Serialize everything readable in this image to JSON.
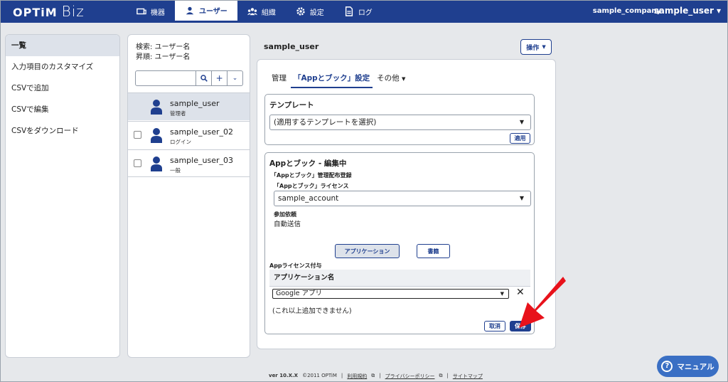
{
  "app": {
    "logo_main": "OPTiM",
    "logo_sub": "Biz",
    "company": "sample_company",
    "current_user": "sample_user"
  },
  "nav": {
    "items": [
      {
        "label": "機器",
        "icon": "device-icon"
      },
      {
        "label": "ユーザー",
        "icon": "user-icon"
      },
      {
        "label": "組織",
        "icon": "org-icon"
      },
      {
        "label": "設定",
        "icon": "gear-icon"
      },
      {
        "label": "ログ",
        "icon": "log-icon"
      }
    ]
  },
  "sidebar": {
    "items": [
      {
        "label": "一覧"
      },
      {
        "label": "入力項目のカスタマイズ"
      },
      {
        "label": "CSVで追加"
      },
      {
        "label": "CSVで編集"
      },
      {
        "label": "CSVをダウンロード"
      }
    ]
  },
  "list": {
    "search_label": "検索: ユーザー名",
    "sort_label": "昇順: ユーザー名",
    "search_placeholder": "",
    "users": [
      {
        "name": "sample_user",
        "role": "管理者"
      },
      {
        "name": "sample_user_02",
        "role": "ログイン"
      },
      {
        "name": "sample_user_03",
        "role": "一般"
      }
    ]
  },
  "detail": {
    "title": "sample_user",
    "op_button": "操作",
    "tabs": [
      {
        "label": "管理"
      },
      {
        "label": "「Appとブック」設定"
      },
      {
        "label": "その他"
      }
    ],
    "template": {
      "title": "テンプレート",
      "select_value": "(適用するテンプレートを選択)",
      "apply_button": "適用"
    },
    "editing": {
      "title": "Appとブック - 編集中",
      "section_label": "「Appとブック」管理配布登録",
      "license_label": "「Appとブック」ライセンス",
      "license_value": "sample_account",
      "join_label": "参加依頼",
      "join_value": "自動送信",
      "app_button": "アプリケーション",
      "book_button": "書籍",
      "grant_label": "Appライセンス付与",
      "column_header": "アプリケーション名",
      "app_value": "Google アプリ",
      "no_more": "(これ以上追加できません)",
      "cancel_button": "取消",
      "save_button": "保存"
    }
  },
  "footer": {
    "version": "ver 10.X.X",
    "copyright": "©2011 OPTiM",
    "terms": "利用規約",
    "privacy": "プライバシーポリシー",
    "sitemap": "サイトマップ"
  },
  "manual_button": "マニュアル",
  "colors": {
    "brand": "#1f3f8f",
    "accent_arrow": "#e8121b",
    "manual": "#3a6fc4"
  }
}
